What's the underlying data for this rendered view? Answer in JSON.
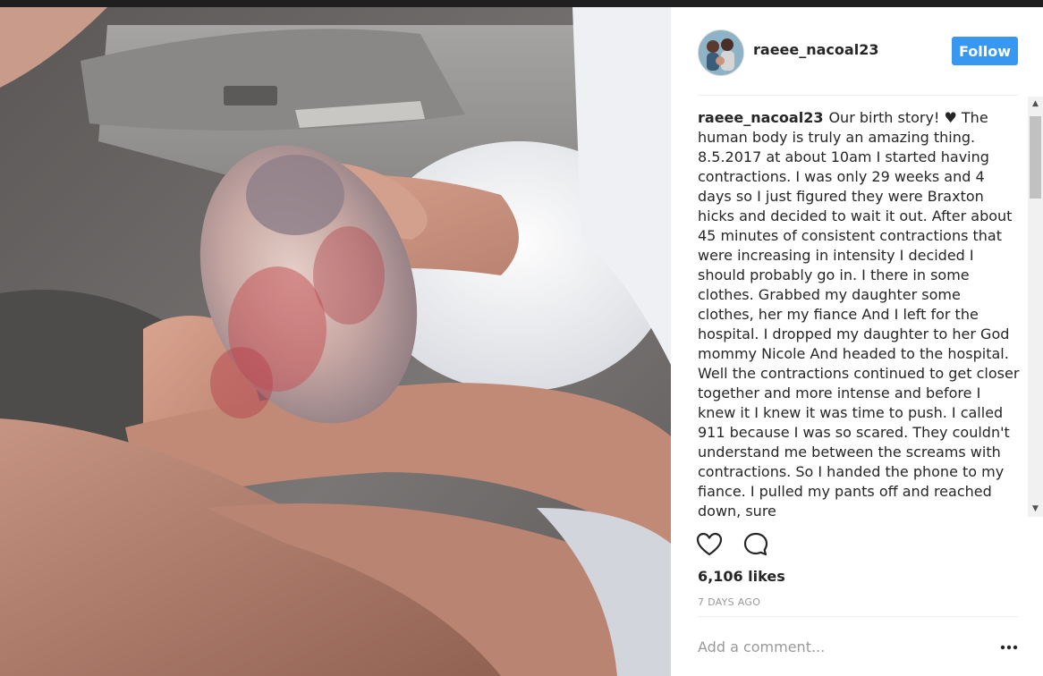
{
  "post": {
    "username": "raeee_nacoal23",
    "follow_label": "Follow",
    "caption_text": "Our birth story! ♥ The human body is truly an amazing thing. 8.5.2017 at about 10am I started having contractions. I was only 29 weeks and 4 days so I just figured they were Braxton hicks and decided to wait it out. After about 45 minutes of consistent contractions that were increasing in intensity I decided I should probably go in. I there in some clothes. Grabbed my daughter some clothes, her my fiance And I left for the hospital. I dropped my daughter to her God mommy Nicole And headed to the hospital. Well the contractions continued to get closer together and more intense and before I knew it I knew it was time to push. I called 911 because I was so scared. They couldn't understand me between the screams with contractions. So I handed the phone to my fiance. I pulled my pants off and reached down, sure",
    "likes": "6,106 likes",
    "timestamp": "7 DAYS AGO"
  },
  "comment": {
    "placeholder": "Add a comment..."
  },
  "icons": {
    "like": "heart-icon",
    "comment": "comment-bubble-icon",
    "more": "more-options-icon",
    "scroll_up": "scroll-up-arrow",
    "scroll_down": "scroll-down-arrow"
  },
  "colors": {
    "follow_button": "#3897f0",
    "text": "#262626",
    "muted": "#999999"
  }
}
